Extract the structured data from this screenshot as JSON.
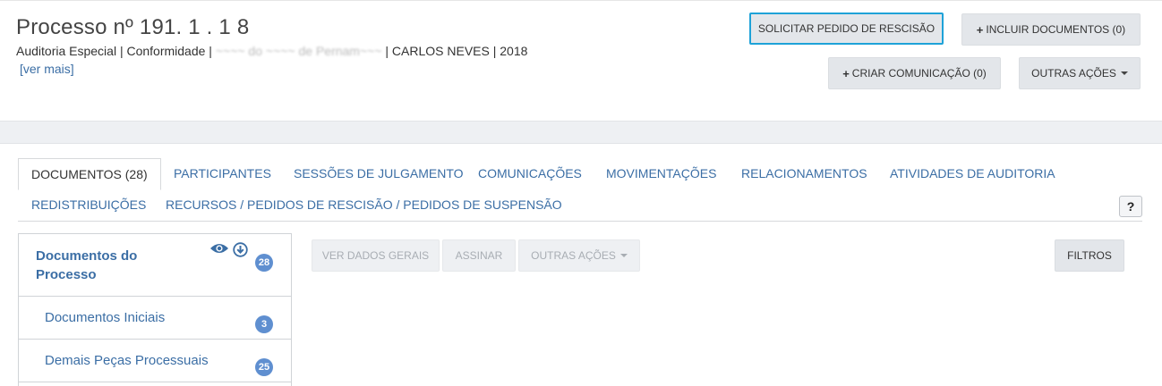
{
  "header": {
    "title": "Processo nº 191. 1 . 1 8",
    "subtitle_part1": "Auditoria Especial | Conformidade |",
    "subtitle_redacted": " ~~~~ do ~~~~ de Pernam~~~ ",
    "subtitle_part2": "| CARLOS NEVES | 2018",
    "ver_mais": "[ver mais]"
  },
  "actions": {
    "solicitar": "SOLICITAR PEDIDO DE RESCISÃO",
    "incluir": "INCLUIR DOCUMENTOS (0)",
    "criar": "CRIAR COMUNICAÇÃO (0)",
    "outras": "OUTRAS AÇÕES"
  },
  "tabs": [
    "DOCUMENTOS (28)",
    "PARTICIPANTES",
    "SESSÕES DE JULGAMENTO",
    "COMUNICAÇÕES",
    "MOVIMENTAÇÕES",
    "RELACIONAMENTOS",
    "ATIVIDADES DE AUDITORIA",
    "REDISTRIBUIÇÕES",
    "RECURSOS / PEDIDOS DE RESCISÃO / PEDIDOS DE SUSPENSÃO"
  ],
  "help_label": "?",
  "sidebar": {
    "head_line1": "Documentos do",
    "head_line2": "Processo",
    "head_count": "28",
    "items": [
      {
        "label": "Documentos Iniciais",
        "count": "3"
      },
      {
        "label": "Demais Peças Processuais",
        "count": "25"
      }
    ]
  },
  "toolbar": {
    "ver_dados": "VER DADOS GERAIS",
    "assinar": "ASSINAR",
    "outras": "OUTRAS AÇÕES",
    "filtros": "FILTROS"
  },
  "colors": {
    "link": "#3b6ea5",
    "badge": "#5f8fd0",
    "highlight_border": "#1ea2d8"
  }
}
